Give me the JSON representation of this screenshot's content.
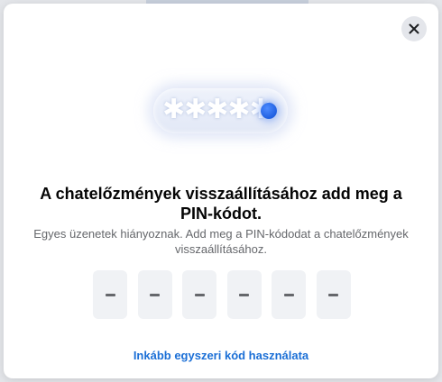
{
  "dialog": {
    "close_icon": "close-icon",
    "illustration": {
      "masked_digits": "✱✱✱✱✱",
      "accent_color": "#1f5fe0"
    },
    "title": "A chatelőzmények visszaállításához add meg a PIN-kódot.",
    "subtitle": "Egyes üzenetek hiányoznak. Add meg a PIN-kódodat a chatelőzmények visszaállításához.",
    "pin": {
      "length": 6,
      "values": [
        "",
        "",
        "",
        "",
        "",
        ""
      ]
    },
    "alt_link": "Inkább egyszeri kód használata",
    "link_color": "#1b6fd6"
  }
}
